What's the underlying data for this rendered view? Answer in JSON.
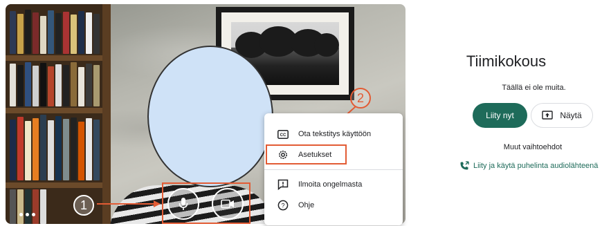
{
  "meeting": {
    "title": "Tiimikokous",
    "status_text": "Täällä ei ole muita.",
    "join_label": "Liity nyt",
    "present_label": "Näytä",
    "other_options_label": "Muut vaihtoehdot",
    "phone_audio_label": "Liity ja käytä puhelinta audiolähteenä"
  },
  "menu": {
    "items": [
      {
        "label": "Ota tekstitys käyttöön",
        "icon": "closed-captions-icon"
      },
      {
        "label": "Asetukset",
        "icon": "settings-gear-icon"
      },
      {
        "label": "Ilmoita ongelmasta",
        "icon": "report-problem-icon"
      },
      {
        "label": "Ohje",
        "icon": "help-icon"
      }
    ]
  },
  "controls": {
    "microphone_icon": "microphone-icon",
    "camera_icon": "camera-icon",
    "more_options_icon": "more-options-dots-icon"
  },
  "annotations": {
    "step1": "1",
    "step2": "2",
    "color": "#e25b34"
  },
  "colors": {
    "accent": "#1e6b5a"
  }
}
